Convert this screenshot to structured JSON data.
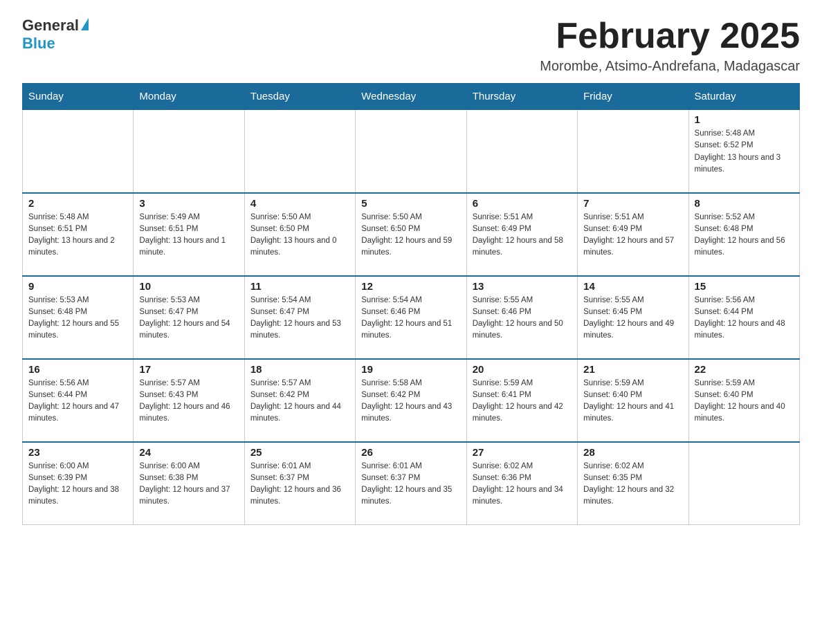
{
  "logo": {
    "general": "General",
    "blue": "Blue"
  },
  "header": {
    "month": "February 2025",
    "location": "Morombe, Atsimo-Andrefana, Madagascar"
  },
  "weekdays": [
    "Sunday",
    "Monday",
    "Tuesday",
    "Wednesday",
    "Thursday",
    "Friday",
    "Saturday"
  ],
  "weeks": [
    [
      {
        "day": "",
        "info": ""
      },
      {
        "day": "",
        "info": ""
      },
      {
        "day": "",
        "info": ""
      },
      {
        "day": "",
        "info": ""
      },
      {
        "day": "",
        "info": ""
      },
      {
        "day": "",
        "info": ""
      },
      {
        "day": "1",
        "info": "Sunrise: 5:48 AM\nSunset: 6:52 PM\nDaylight: 13 hours and 3 minutes."
      }
    ],
    [
      {
        "day": "2",
        "info": "Sunrise: 5:48 AM\nSunset: 6:51 PM\nDaylight: 13 hours and 2 minutes."
      },
      {
        "day": "3",
        "info": "Sunrise: 5:49 AM\nSunset: 6:51 PM\nDaylight: 13 hours and 1 minute."
      },
      {
        "day": "4",
        "info": "Sunrise: 5:50 AM\nSunset: 6:50 PM\nDaylight: 13 hours and 0 minutes."
      },
      {
        "day": "5",
        "info": "Sunrise: 5:50 AM\nSunset: 6:50 PM\nDaylight: 12 hours and 59 minutes."
      },
      {
        "day": "6",
        "info": "Sunrise: 5:51 AM\nSunset: 6:49 PM\nDaylight: 12 hours and 58 minutes."
      },
      {
        "day": "7",
        "info": "Sunrise: 5:51 AM\nSunset: 6:49 PM\nDaylight: 12 hours and 57 minutes."
      },
      {
        "day": "8",
        "info": "Sunrise: 5:52 AM\nSunset: 6:48 PM\nDaylight: 12 hours and 56 minutes."
      }
    ],
    [
      {
        "day": "9",
        "info": "Sunrise: 5:53 AM\nSunset: 6:48 PM\nDaylight: 12 hours and 55 minutes."
      },
      {
        "day": "10",
        "info": "Sunrise: 5:53 AM\nSunset: 6:47 PM\nDaylight: 12 hours and 54 minutes."
      },
      {
        "day": "11",
        "info": "Sunrise: 5:54 AM\nSunset: 6:47 PM\nDaylight: 12 hours and 53 minutes."
      },
      {
        "day": "12",
        "info": "Sunrise: 5:54 AM\nSunset: 6:46 PM\nDaylight: 12 hours and 51 minutes."
      },
      {
        "day": "13",
        "info": "Sunrise: 5:55 AM\nSunset: 6:46 PM\nDaylight: 12 hours and 50 minutes."
      },
      {
        "day": "14",
        "info": "Sunrise: 5:55 AM\nSunset: 6:45 PM\nDaylight: 12 hours and 49 minutes."
      },
      {
        "day": "15",
        "info": "Sunrise: 5:56 AM\nSunset: 6:44 PM\nDaylight: 12 hours and 48 minutes."
      }
    ],
    [
      {
        "day": "16",
        "info": "Sunrise: 5:56 AM\nSunset: 6:44 PM\nDaylight: 12 hours and 47 minutes."
      },
      {
        "day": "17",
        "info": "Sunrise: 5:57 AM\nSunset: 6:43 PM\nDaylight: 12 hours and 46 minutes."
      },
      {
        "day": "18",
        "info": "Sunrise: 5:57 AM\nSunset: 6:42 PM\nDaylight: 12 hours and 44 minutes."
      },
      {
        "day": "19",
        "info": "Sunrise: 5:58 AM\nSunset: 6:42 PM\nDaylight: 12 hours and 43 minutes."
      },
      {
        "day": "20",
        "info": "Sunrise: 5:59 AM\nSunset: 6:41 PM\nDaylight: 12 hours and 42 minutes."
      },
      {
        "day": "21",
        "info": "Sunrise: 5:59 AM\nSunset: 6:40 PM\nDaylight: 12 hours and 41 minutes."
      },
      {
        "day": "22",
        "info": "Sunrise: 5:59 AM\nSunset: 6:40 PM\nDaylight: 12 hours and 40 minutes."
      }
    ],
    [
      {
        "day": "23",
        "info": "Sunrise: 6:00 AM\nSunset: 6:39 PM\nDaylight: 12 hours and 38 minutes."
      },
      {
        "day": "24",
        "info": "Sunrise: 6:00 AM\nSunset: 6:38 PM\nDaylight: 12 hours and 37 minutes."
      },
      {
        "day": "25",
        "info": "Sunrise: 6:01 AM\nSunset: 6:37 PM\nDaylight: 12 hours and 36 minutes."
      },
      {
        "day": "26",
        "info": "Sunrise: 6:01 AM\nSunset: 6:37 PM\nDaylight: 12 hours and 35 minutes."
      },
      {
        "day": "27",
        "info": "Sunrise: 6:02 AM\nSunset: 6:36 PM\nDaylight: 12 hours and 34 minutes."
      },
      {
        "day": "28",
        "info": "Sunrise: 6:02 AM\nSunset: 6:35 PM\nDaylight: 12 hours and 32 minutes."
      },
      {
        "day": "",
        "info": ""
      }
    ]
  ]
}
